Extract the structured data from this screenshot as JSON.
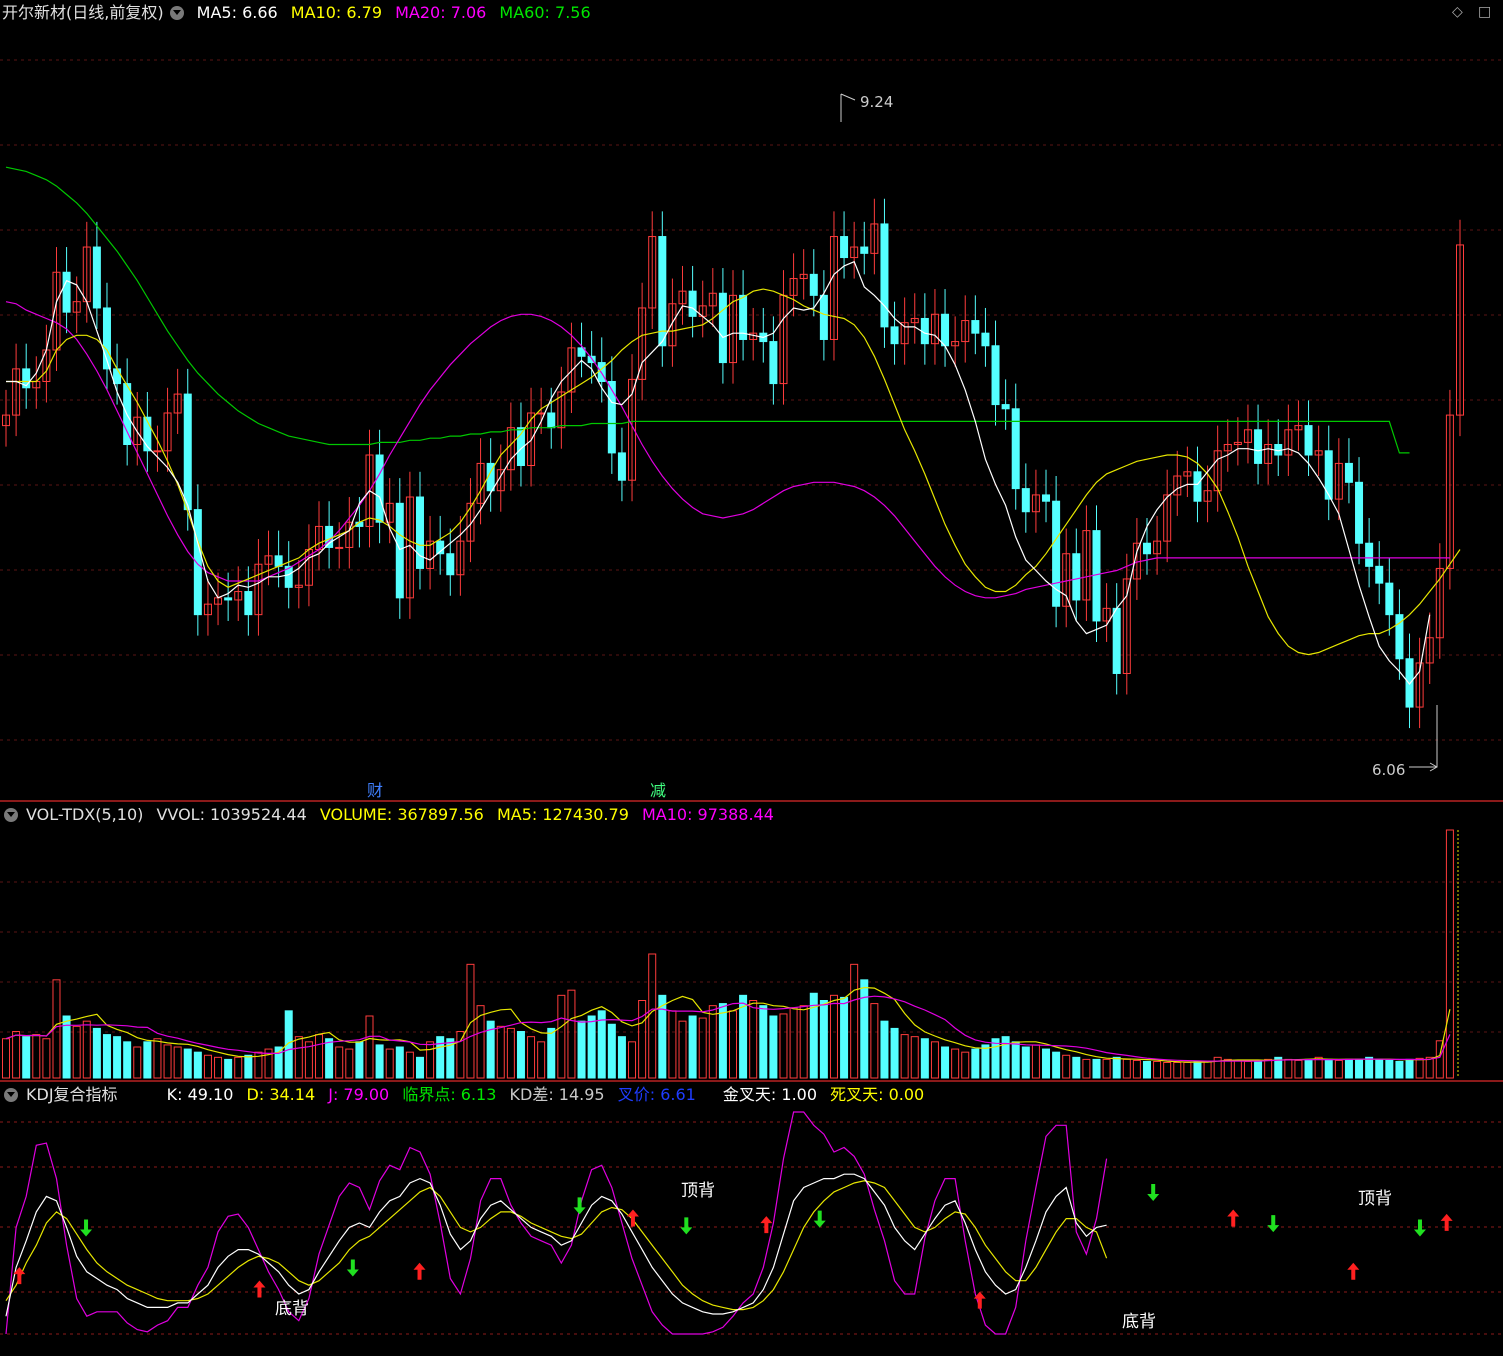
{
  "main": {
    "title": "开尔新材(日线,前复权)",
    "ma_items": [
      {
        "label": "MA5: 6.66",
        "color": "#ffffff"
      },
      {
        "label": "MA10: 6.79",
        "color": "#ffff00"
      },
      {
        "label": "MA20: 7.06",
        "color": "#ff00ff"
      },
      {
        "label": "MA60: 7.56",
        "color": "#00e600"
      }
    ],
    "high_label": "9.24",
    "low_label": "6.06",
    "event_markers": [
      "财",
      "减"
    ],
    "corner_icons": [
      "diamond-icon",
      "square-icon"
    ]
  },
  "volume": {
    "title": "VOL-TDX(5,10)",
    "items": [
      {
        "label": "VVOL: 1039524.44",
        "color": "#e0e0e0"
      },
      {
        "label": "VOLUME: 367897.56",
        "color": "#ffff00"
      },
      {
        "label": "MA5: 127430.79",
        "color": "#ffff00"
      },
      {
        "label": "MA10: 97388.44",
        "color": "#ff00ff"
      }
    ]
  },
  "kdj": {
    "title": "KDJ复合指标",
    "items": [
      {
        "label": "K: 49.10",
        "color": "#ffffff"
      },
      {
        "label": "D: 34.14",
        "color": "#ffff00"
      },
      {
        "label": "J: 79.00",
        "color": "#ff00ff"
      },
      {
        "label": "临界点: 6.13",
        "color": "#00e600"
      },
      {
        "label": "KD差: 14.95",
        "color": "#c8c8c8"
      },
      {
        "label": "叉价: 6.61",
        "color": "#1e3cff"
      },
      {
        "label": "金叉天: 1.00",
        "color": "#ffffff"
      },
      {
        "label": "死叉天: 0.00",
        "color": "#ffff00"
      }
    ],
    "annotations": [
      "底背",
      "顶背",
      "底背",
      "顶背"
    ]
  },
  "chart_data": {
    "type": "candlestick",
    "price_range": [
      6.06,
      9.24
    ],
    "close": [
      7.74,
      7.96,
      7.87,
      7.9,
      8.05,
      8.42,
      8.23,
      8.28,
      8.54,
      8.25,
      7.96,
      7.89,
      7.6,
      7.73,
      7.57,
      7.57,
      7.75,
      7.84,
      7.29,
      6.79,
      6.84,
      6.87,
      6.86,
      6.9,
      6.79,
      7.03,
      7.07,
      7.02,
      6.92,
      6.93,
      7.1,
      7.21,
      7.11,
      7.11,
      7.23,
      7.21,
      7.55,
      7.23,
      7.32,
      6.87,
      7.35,
      7.01,
      7.14,
      7.08,
      6.98,
      7.14,
      7.32,
      7.51,
      7.38,
      7.48,
      7.68,
      7.5,
      7.75,
      7.75,
      7.68,
      7.85,
      8.06,
      8.02,
      7.99,
      7.9,
      7.56,
      7.43,
      7.91,
      8.25,
      8.59,
      8.07,
      8.27,
      8.33,
      8.21,
      8.26,
      8.32,
      7.99,
      8.31,
      8.1,
      8.13,
      8.09,
      7.89,
      8.31,
      8.39,
      8.41,
      8.31,
      8.1,
      8.59,
      8.49,
      8.54,
      8.51,
      8.65,
      8.16,
      8.08,
      8.18,
      8.2,
      8.08,
      8.22,
      8.07,
      8.09,
      8.19,
      8.13,
      8.07,
      7.79,
      7.77,
      7.39,
      7.28,
      7.36,
      7.33,
      6.83,
      7.08,
      6.86,
      7.19,
      6.76,
      6.82,
      6.51,
      6.96,
      7.13,
      7.08,
      7.14,
      7.36,
      7.45,
      7.47,
      7.33,
      7.38,
      7.57,
      7.6,
      7.61,
      7.67,
      7.51,
      7.6,
      7.55,
      7.67,
      7.69,
      7.55,
      7.57,
      7.34,
      7.51,
      7.42,
      7.13,
      7.02,
      6.94,
      6.79,
      6.58,
      6.35,
      6.56,
      6.68,
      7.01,
      7.74,
      8.55
    ],
    "ma5": [
      7.9,
      7.9,
      7.88,
      7.94,
      8.05,
      8.28,
      8.38,
      8.36,
      8.28,
      8.14,
      8.0,
      7.85,
      7.74,
      7.66,
      7.59,
      7.54,
      7.49,
      7.42,
      7.31,
      7.13,
      6.95,
      6.87,
      6.89,
      6.93,
      6.92,
      6.94,
      6.97,
      6.97,
      6.98,
      7.01,
      7.06,
      7.08,
      7.13,
      7.16,
      7.19,
      7.32,
      7.38,
      7.35,
      7.2,
      7.1,
      7.12,
      7.07,
      7.05,
      7.09,
      7.13,
      7.17,
      7.22,
      7.29,
      7.37,
      7.45,
      7.53,
      7.58,
      7.62,
      7.71,
      7.82,
      7.9,
      7.95,
      8.0,
      7.96,
      7.87,
      7.8,
      7.79,
      7.84,
      7.99,
      8.04,
      8.09,
      8.18,
      8.26,
      8.25,
      8.21,
      8.17,
      8.11,
      8.13,
      8.13,
      8.12,
      8.11,
      8.13,
      8.2,
      8.25,
      8.24,
      8.25,
      8.32,
      8.41,
      8.45,
      8.47,
      8.35,
      8.31,
      8.26,
      8.2,
      8.16,
      8.16,
      8.13,
      8.12,
      8.07,
      7.98,
      7.86,
      7.71,
      7.53,
      7.41,
      7.31,
      7.16,
      7.05,
      7.0,
      6.95,
      6.91,
      6.88,
      6.76,
      6.7,
      6.72,
      6.74,
      6.82,
      6.88,
      7.09,
      7.21,
      7.29,
      7.35,
      7.39,
      7.41,
      7.41,
      7.47,
      7.53,
      7.55,
      7.58,
      7.58,
      7.57,
      7.58,
      7.57,
      7.58,
      7.56,
      7.51,
      7.44,
      7.36,
      7.27,
      7.1,
      6.93,
      6.78,
      6.64,
      6.57,
      6.52,
      6.46,
      6.52,
      6.79
    ],
    "ma10": [
      7.9,
      7.9,
      7.9,
      7.9,
      7.95,
      8.05,
      8.1,
      8.12,
      8.12,
      8.1,
      8.05,
      7.96,
      7.88,
      7.8,
      7.71,
      7.62,
      7.52,
      7.41,
      7.28,
      7.14,
      7.02,
      6.95,
      6.92,
      6.94,
      6.96,
      6.98,
      7.0,
      7.02,
      7.04,
      7.06,
      7.1,
      7.13,
      7.15,
      7.17,
      7.19,
      7.23,
      7.25,
      7.24,
      7.21,
      7.17,
      7.14,
      7.12,
      7.12,
      7.15,
      7.18,
      7.23,
      7.3,
      7.38,
      7.47,
      7.55,
      7.6,
      7.65,
      7.72,
      7.77,
      7.8,
      7.83,
      7.86,
      7.89,
      7.92,
      7.96,
      8.0,
      8.05,
      8.09,
      8.12,
      8.13,
      8.14,
      8.14,
      8.15,
      8.16,
      8.17,
      8.2,
      8.24,
      8.28,
      8.3,
      8.33,
      8.34,
      8.33,
      8.31,
      8.29,
      8.26,
      8.24,
      8.22,
      8.21,
      8.2,
      8.17,
      8.11,
      8.02,
      7.91,
      7.79,
      7.67,
      7.57,
      7.46,
      7.34,
      7.22,
      7.12,
      7.03,
      6.97,
      6.92,
      6.9,
      6.9,
      6.93,
      6.98,
      7.02,
      7.08,
      7.15,
      7.22,
      7.29,
      7.36,
      7.42,
      7.46,
      7.48,
      7.5,
      7.52,
      7.53,
      7.54,
      7.55,
      7.55,
      7.54,
      7.51,
      7.46,
      7.39,
      7.28,
      7.16,
      7.02,
      6.9,
      6.78,
      6.7,
      6.64,
      6.61,
      6.6,
      6.61,
      6.63,
      6.65,
      6.67,
      6.69,
      6.7,
      6.7,
      6.72,
      6.75,
      6.79,
      6.84,
      6.9,
      6.96,
      7.03,
      7.1
    ],
    "ma20": [
      8.28,
      8.27,
      8.24,
      8.22,
      8.2,
      8.18,
      8.15,
      8.1,
      8.03,
      7.95,
      7.86,
      7.76,
      7.66,
      7.56,
      7.46,
      7.36,
      7.26,
      7.17,
      7.09,
      7.03,
      6.99,
      6.97,
      6.95,
      6.95,
      6.95,
      6.95,
      6.97,
      6.99,
      7.01,
      7.04,
      7.07,
      7.1,
      7.14,
      7.19,
      7.25,
      7.31,
      7.38,
      7.46,
      7.55,
      7.63,
      7.71,
      7.79,
      7.86,
      7.92,
      7.98,
      8.03,
      8.08,
      8.12,
      8.16,
      8.19,
      8.21,
      8.22,
      8.22,
      8.21,
      8.19,
      8.16,
      8.12,
      8.07,
      8.01,
      7.94,
      7.86,
      7.78,
      7.69,
      7.6,
      7.52,
      7.45,
      7.39,
      7.34,
      7.3,
      7.27,
      7.26,
      7.25,
      7.26,
      7.27,
      7.29,
      7.32,
      7.35,
      7.38,
      7.4,
      7.41,
      7.42,
      7.42,
      7.42,
      7.41,
      7.4,
      7.38,
      7.35,
      7.31,
      7.26,
      7.2,
      7.14,
      7.08,
      7.02,
      6.97,
      6.93,
      6.9,
      6.88,
      6.87,
      6.87,
      6.88,
      6.89,
      6.91,
      6.92,
      6.93,
      6.94,
      6.95,
      6.96,
      6.97,
      6.98,
      6.99,
      7.0,
      7.02,
      7.04,
      7.05,
      7.06,
      7.06,
      7.06,
      7.06,
      7.06,
      7.06,
      7.06,
      7.06,
      7.06,
      7.06,
      7.06,
      7.06,
      7.06,
      7.06,
      7.06,
      7.06,
      7.06,
      7.06,
      7.06,
      7.06,
      7.06,
      7.06,
      7.06,
      7.06,
      7.06,
      7.06,
      7.06,
      7.06,
      7.06,
      7.06
    ],
    "ma60": [
      8.92,
      8.91,
      8.9,
      8.88,
      8.86,
      8.83,
      8.79,
      8.75,
      8.7,
      8.64,
      8.58,
      8.52,
      8.45,
      8.38,
      8.3,
      8.22,
      8.14,
      8.07,
      8.0,
      7.94,
      7.89,
      7.84,
      7.8,
      7.76,
      7.73,
      7.7,
      7.68,
      7.66,
      7.64,
      7.63,
      7.62,
      7.61,
      7.6,
      7.6,
      7.6,
      7.6,
      7.6,
      7.61,
      7.61,
      7.61,
      7.62,
      7.62,
      7.63,
      7.63,
      7.64,
      7.64,
      7.65,
      7.65,
      7.66,
      7.66,
      7.67,
      7.67,
      7.68,
      7.68,
      7.68,
      7.69,
      7.69,
      7.69,
      7.7,
      7.7,
      7.7,
      7.7,
      7.71,
      7.71,
      7.71,
      7.71,
      7.71,
      7.71,
      7.71,
      7.71,
      7.71,
      7.71,
      7.71,
      7.71,
      7.71,
      7.71,
      7.71,
      7.71,
      7.71,
      7.71,
      7.71,
      7.71,
      7.71,
      7.71,
      7.71,
      7.71,
      7.71,
      7.71,
      7.71,
      7.71,
      7.71,
      7.71,
      7.71,
      7.71,
      7.71,
      7.71,
      7.71,
      7.71,
      7.71,
      7.71,
      7.71,
      7.71,
      7.71,
      7.71,
      7.71,
      7.71,
      7.71,
      7.71,
      7.71,
      7.71,
      7.71,
      7.71,
      7.71,
      7.71,
      7.71,
      7.71,
      7.71,
      7.71,
      7.71,
      7.71,
      7.71,
      7.71,
      7.71,
      7.71,
      7.71,
      7.71,
      7.71,
      7.71,
      7.71,
      7.71,
      7.71,
      7.71,
      7.71,
      7.71,
      7.71,
      7.71,
      7.71,
      7.71,
      7.56,
      7.56
    ],
    "volume_range": [
      0,
      1039524.44
    ],
    "volume": [
      38,
      45,
      40,
      42,
      38,
      95,
      60,
      50,
      55,
      48,
      42,
      40,
      35,
      30,
      35,
      38,
      32,
      30,
      28,
      25,
      22,
      20,
      18,
      20,
      22,
      25,
      28,
      30,
      65,
      40,
      35,
      42,
      38,
      30,
      28,
      35,
      60,
      32,
      28,
      30,
      25,
      20,
      35,
      40,
      38,
      45,
      110,
      70,
      55,
      50,
      48,
      45,
      40,
      35,
      48,
      80,
      85,
      55,
      60,
      65,
      52,
      40,
      35,
      75,
      120,
      80,
      65,
      55,
      60,
      58,
      70,
      72,
      65,
      80,
      75,
      70,
      60,
      62,
      68,
      70,
      82,
      75,
      80,
      78,
      110,
      95,
      72,
      55,
      48,
      42,
      40,
      38,
      35,
      30,
      28,
      25,
      28,
      32,
      38,
      40,
      35,
      30,
      32,
      28,
      25,
      22,
      20,
      18,
      18,
      18,
      20,
      18,
      17,
      16,
      16,
      15,
      15,
      15,
      16,
      16,
      20,
      18,
      17,
      16,
      16,
      18,
      20,
      18,
      17,
      18,
      20,
      18,
      17,
      18,
      18,
      20,
      18,
      17,
      16,
      18,
      19,
      20,
      36,
      240
    ],
    "kdj": {
      "k": [
        8,
        30,
        42,
        55,
        62,
        60,
        48,
        35,
        28,
        25,
        22,
        20,
        16,
        14,
        12,
        12,
        12,
        14,
        14,
        18,
        22,
        30,
        35,
        38,
        38,
        36,
        32,
        28,
        22,
        18,
        20,
        28,
        35,
        42,
        48,
        50,
        48,
        55,
        60,
        62,
        68,
        70,
        68,
        58,
        45,
        38,
        42,
        52,
        58,
        60,
        56,
        52,
        48,
        46,
        44,
        40,
        42,
        50,
        58,
        62,
        60,
        54,
        46,
        38,
        30,
        24,
        18,
        14,
        12,
        10,
        9,
        9,
        10,
        12,
        14,
        20,
        30,
        45,
        60,
        66,
        68,
        70,
        70,
        72,
        72,
        70,
        64,
        58,
        48,
        42,
        38,
        45,
        52,
        58,
        60,
        50,
        38,
        28,
        22,
        18,
        20,
        30,
        42,
        55,
        62,
        66,
        50,
        44,
        48,
        49
      ],
      "d": [
        15,
        22,
        32,
        40,
        50,
        55,
        52,
        45,
        38,
        32,
        28,
        25,
        22,
        20,
        18,
        16,
        15,
        15,
        15,
        16,
        18,
        22,
        26,
        30,
        33,
        35,
        34,
        32,
        28,
        24,
        22,
        24,
        28,
        32,
        38,
        42,
        44,
        48,
        52,
        56,
        60,
        64,
        66,
        62,
        55,
        48,
        46,
        48,
        52,
        55,
        55,
        53,
        50,
        48,
        46,
        44,
        43,
        45,
        50,
        55,
        57,
        56,
        52,
        46,
        40,
        34,
        28,
        22,
        18,
        15,
        13,
        12,
        11,
        11,
        12,
        15,
        20,
        28,
        38,
        48,
        55,
        60,
        64,
        66,
        68,
        69,
        68,
        66,
        60,
        54,
        48,
        46,
        48,
        52,
        55,
        54,
        48,
        40,
        34,
        28,
        24,
        24,
        30,
        38,
        46,
        52,
        52,
        48,
        46,
        34.14
      ],
      "j": [
        0,
        48,
        62,
        85,
        86,
        70,
        40,
        16,
        8,
        10,
        10,
        10,
        5,
        2,
        1,
        4,
        6,
        12,
        12,
        22,
        30,
        46,
        53,
        54,
        48,
        38,
        28,
        20,
        10,
        6,
        16,
        36,
        49,
        62,
        68,
        66,
        56,
        69,
        76,
        74,
        84,
        82,
        72,
        50,
        25,
        18,
        34,
        60,
        70,
        70,
        58,
        50,
        44,
        42,
        40,
        32,
        40,
        60,
        74,
        76,
        66,
        50,
        34,
        22,
        10,
        4,
        0,
        0,
        0,
        0,
        1,
        3,
        8,
        14,
        18,
        30,
        50,
        79,
        100,
        100,
        94,
        90,
        82,
        84,
        80,
        72,
        56,
        42,
        24,
        18,
        18,
        43,
        60,
        70,
        70,
        42,
        18,
        4,
        0,
        0,
        12,
        42,
        66,
        89,
        94,
        94,
        46,
        36,
        52,
        79
      ]
    },
    "x_range_bars": 146
  }
}
